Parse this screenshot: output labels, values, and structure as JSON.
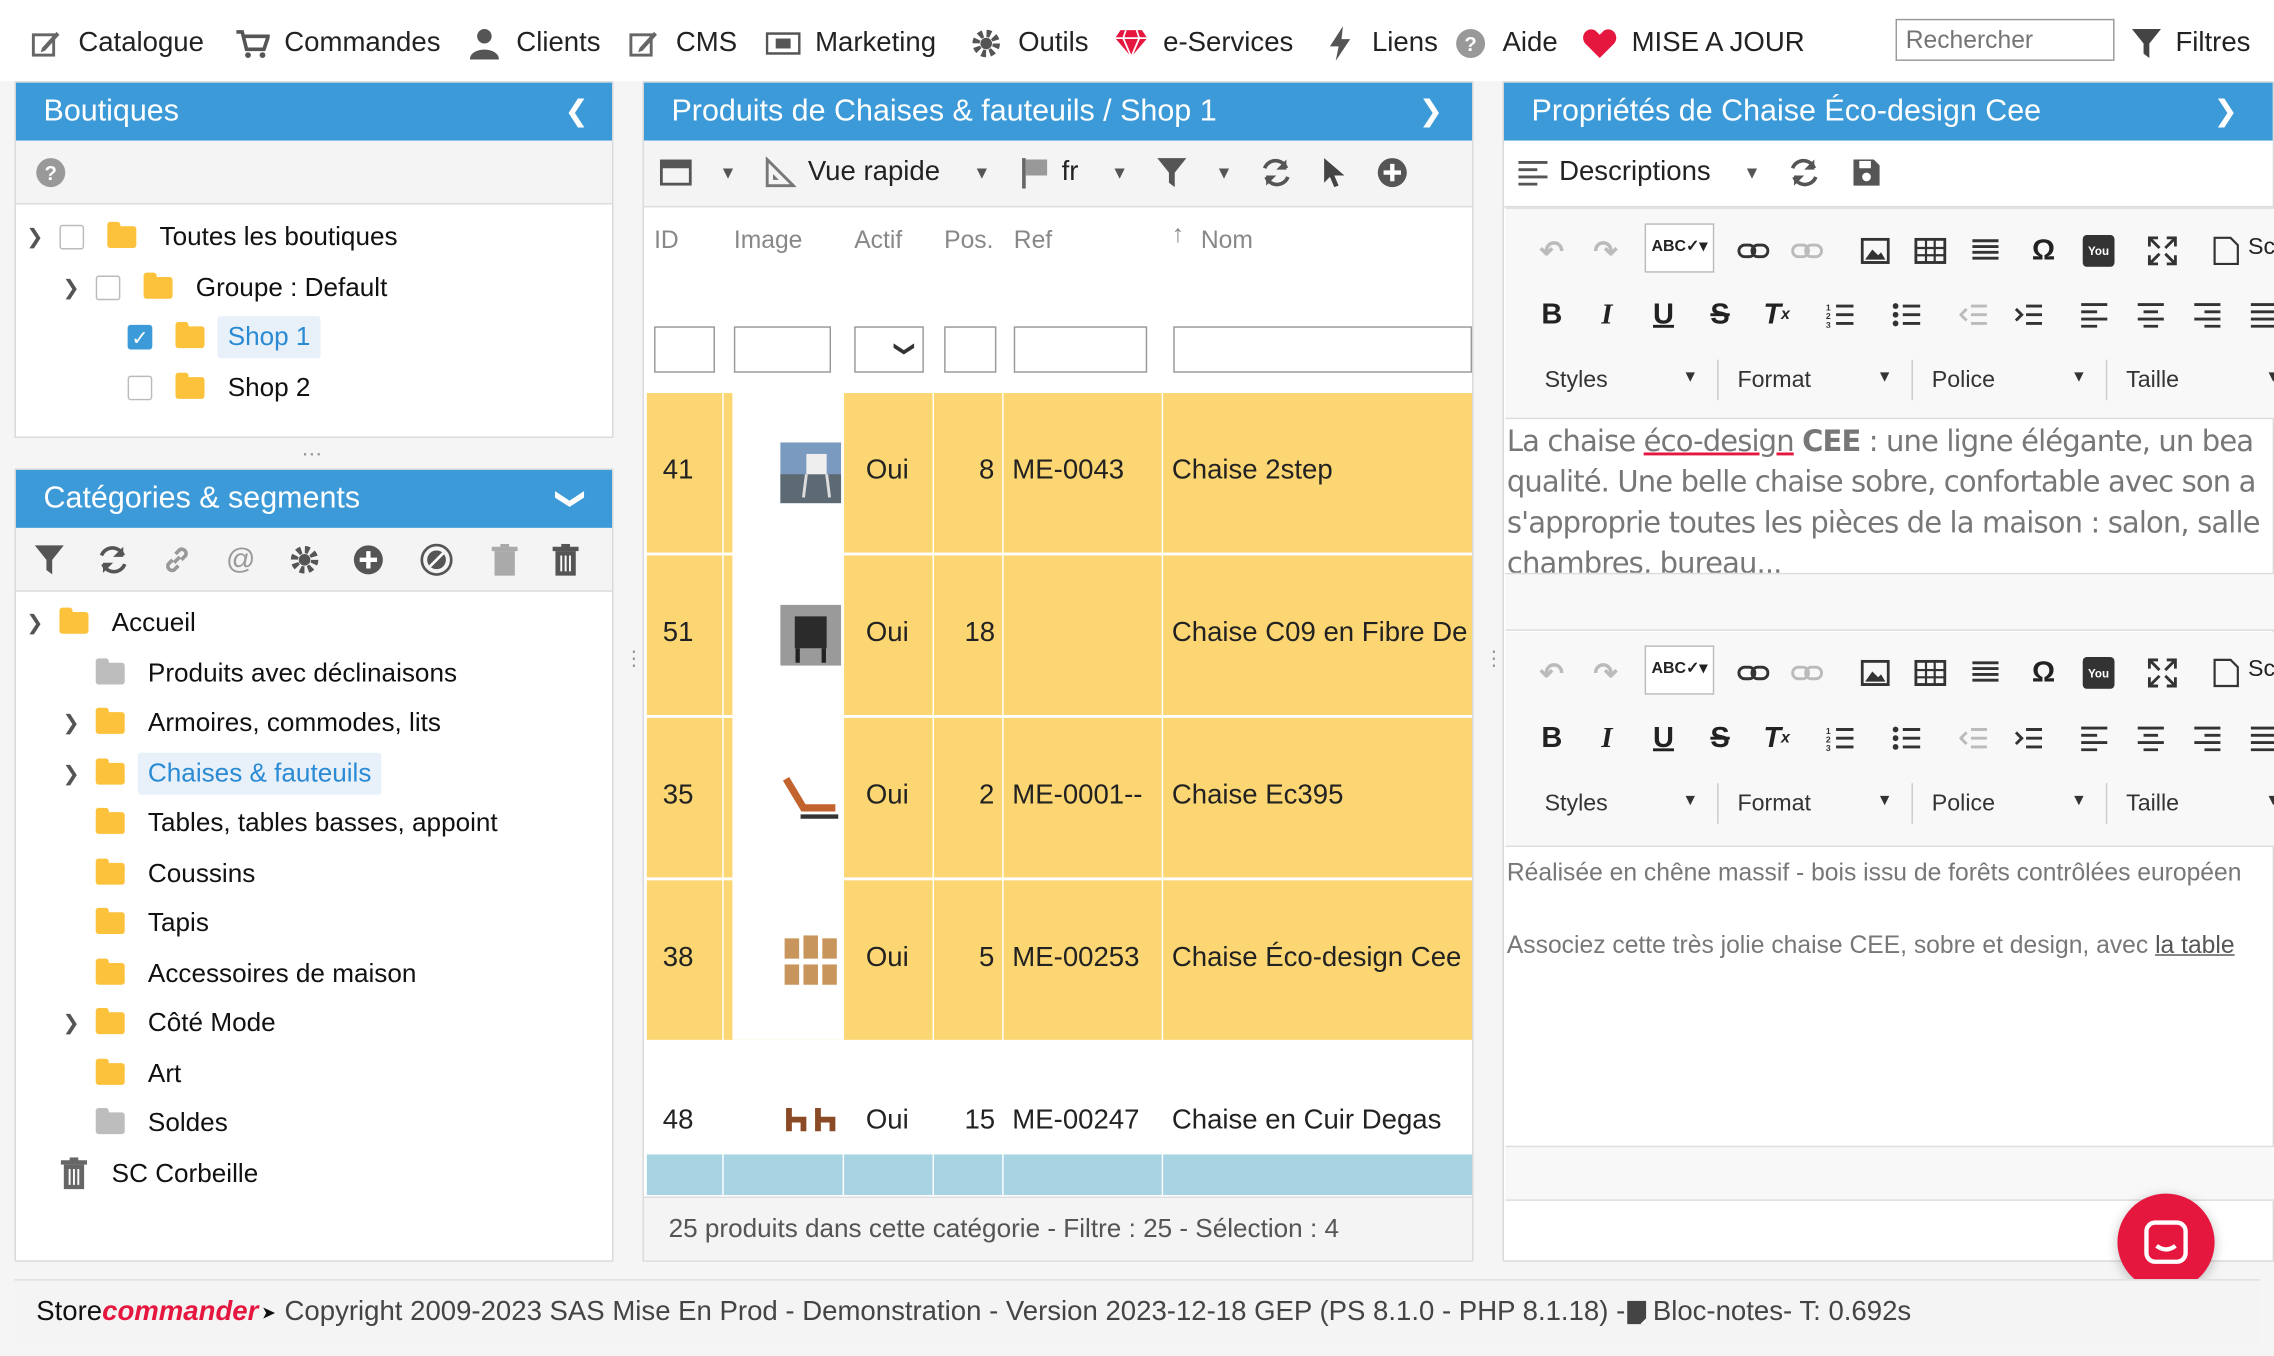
{
  "menu": {
    "items": [
      {
        "label": "Catalogue",
        "icon": "edit-icon"
      },
      {
        "label": "Commandes",
        "icon": "cart-icon"
      },
      {
        "label": "Clients",
        "icon": "user-icon"
      },
      {
        "label": "CMS",
        "icon": "edit-icon"
      },
      {
        "label": "Marketing",
        "icon": "ticket-icon"
      },
      {
        "label": "Outils",
        "icon": "gear-icon"
      },
      {
        "label": "e-Services",
        "icon": "gem-icon"
      },
      {
        "label": "Liens",
        "icon": "bolt-icon"
      },
      {
        "label": "Aide",
        "icon": "help-icon"
      },
      {
        "label": "MISE A JOUR",
        "icon": "heart-icon"
      }
    ],
    "search_placeholder": "Rechercher",
    "filters_label": "Filtres"
  },
  "shops": {
    "title": "Boutiques",
    "tree": [
      {
        "label": "Toutes les boutiques",
        "checked": false
      },
      {
        "label": "Groupe : Default",
        "checked": false
      },
      {
        "label": "Shop 1",
        "checked": true
      },
      {
        "label": "Shop 2",
        "checked": false
      }
    ]
  },
  "categories": {
    "title": "Catégories & segments",
    "tree": [
      {
        "label": "Accueil"
      },
      {
        "label": "Produits avec déclinaisons"
      },
      {
        "label": "Armoires, commodes, lits"
      },
      {
        "label": "Chaises & fauteuils"
      },
      {
        "label": "Tables, tables basses, appoint"
      },
      {
        "label": "Coussins"
      },
      {
        "label": "Tapis"
      },
      {
        "label": "Accessoires de maison"
      },
      {
        "label": "Côté Mode"
      },
      {
        "label": "Art"
      },
      {
        "label": "Soldes"
      },
      {
        "label": "SC Corbeille"
      }
    ]
  },
  "products": {
    "title": "Produits de Chaises & fauteuils / Shop 1",
    "toolbar": {
      "view": "Vue rapide",
      "lang": "fr"
    },
    "columns": [
      "ID",
      "Image",
      "Actif",
      "Pos.",
      "Ref",
      "Nom"
    ],
    "rows": [
      {
        "id": "41",
        "active": "Oui",
        "pos": "8",
        "ref": "ME-0043",
        "name": "Chaise 2step",
        "selected": true
      },
      {
        "id": "51",
        "active": "Oui",
        "pos": "18",
        "ref": "",
        "name": "Chaise C09 en Fibre De",
        "selected": true
      },
      {
        "id": "35",
        "active": "Oui",
        "pos": "2",
        "ref": "ME-0001--",
        "name": "Chaise Ec395",
        "selected": true
      },
      {
        "id": "38",
        "active": "Oui",
        "pos": "5",
        "ref": "ME-00253",
        "name": "Chaise Éco-design Cee",
        "selected": true
      },
      {
        "id": "48",
        "active": "Oui",
        "pos": "15",
        "ref": "ME-00247",
        "name": "Chaise en Cuir Degas",
        "selected": false
      }
    ],
    "status": "25 produits dans cette catégorie - Filtre : 25 - Sélection : 4"
  },
  "properties": {
    "title": "Propriétés de Chaise Éco-design Cee",
    "toolbar": {
      "mode": "Descriptions"
    },
    "editor": {
      "styles": "Styles",
      "format": "Format",
      "font": "Police",
      "size": "Taille",
      "source": "Sc"
    },
    "desc_short": {
      "pre": "La chaise ",
      "underlined": "éco-design",
      "bold": "CEE",
      "rest": " : une ligne élégante, un bea qualité. Une belle chaise sobre, confortable avec son a s'approprie toutes les pièces de la maison : salon, salle chambres, bureau..."
    },
    "desc_long": {
      "p1": "Réalisée en chêne massif - bois issu de forêts contrôlées européen",
      "p2_text": "Associez cette très jolie chaise CEE, sobre et design, avec ",
      "p2_link": "la table"
    }
  },
  "footer": {
    "brand_a": "Store",
    "brand_b": "commander",
    "text": "Copyright 2009-2023 SAS Mise En Prod - Demonstration - Version 2023-12-18 GEP (PS 8.1.0 - PHP 8.1.18) - ",
    "notes": "Bloc-notes",
    "timing": " - T: 0.692s"
  },
  "colors": {
    "accent": "#3c9ad8",
    "selected_row": "#fcd672",
    "chat": "#e5173f"
  }
}
